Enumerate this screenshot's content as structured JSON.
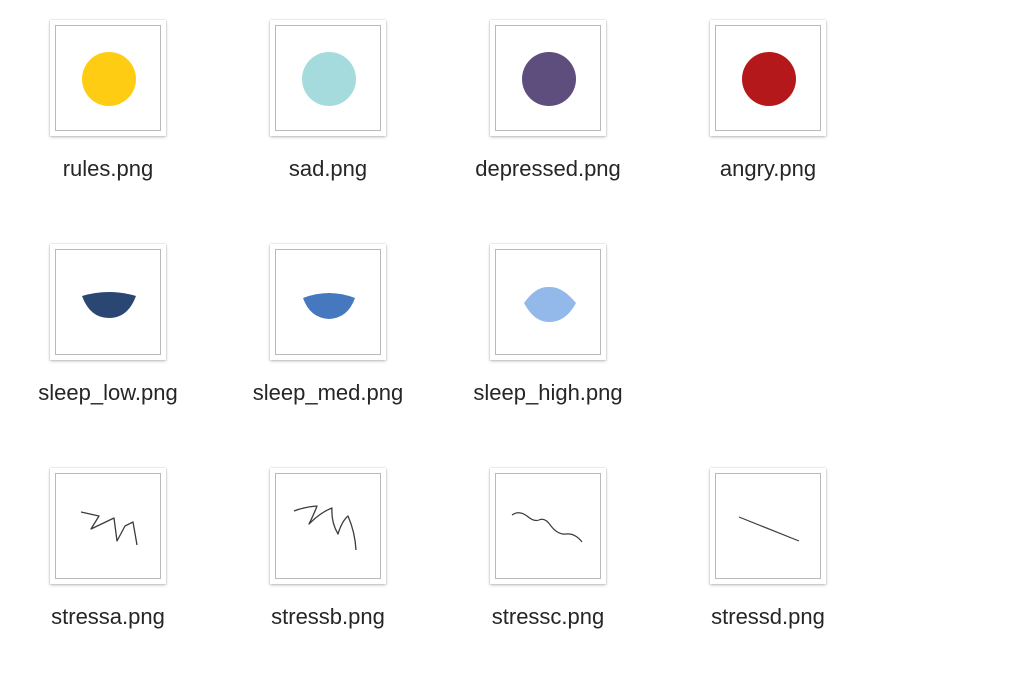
{
  "files": [
    {
      "name": "rules.png",
      "thumbnail": "yellow-circle",
      "color": "#FFCC14"
    },
    {
      "name": "sad.png",
      "thumbnail": "light-teal-circle",
      "color": "#A6DBDD"
    },
    {
      "name": "depressed.png",
      "thumbnail": "purple-circle",
      "color": "#5D4E7D"
    },
    {
      "name": "angry.png",
      "thumbnail": "red-circle",
      "color": "#B5181A"
    },
    {
      "name": "sleep_low.png",
      "thumbnail": "navy-bowl-shape",
      "color": "#2A4773"
    },
    {
      "name": "sleep_med.png",
      "thumbnail": "blue-bowl-shape",
      "color": "#4678C0"
    },
    {
      "name": "sleep_high.png",
      "thumbnail": "light-blue-lens-shape",
      "color": "#92B9EA"
    },
    {
      "name": "stressa.png",
      "thumbnail": "zigzag-scribble",
      "color": "#3C3C3C"
    },
    {
      "name": "stressb.png",
      "thumbnail": "zigzag-scribble-large",
      "color": "#3C3C3C"
    },
    {
      "name": "stressc.png",
      "thumbnail": "wavy-line",
      "color": "#3C3C3C"
    },
    {
      "name": "stressd.png",
      "thumbnail": "straight-diagonal-line",
      "color": "#3C3C3C"
    }
  ]
}
